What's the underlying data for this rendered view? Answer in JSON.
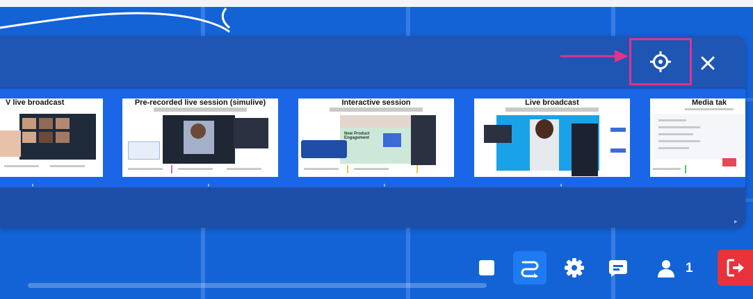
{
  "slides": [
    {
      "title": "V live broadcast"
    },
    {
      "title": "Pre-recorded live session (simulive)"
    },
    {
      "title": "Interactive session"
    },
    {
      "title": "Live broadcast"
    },
    {
      "title": "Media tak"
    }
  ],
  "interactive_thumb_overlay": "New Product Engagement",
  "toolbar": {
    "participant_count": "1"
  },
  "colors": {
    "highlight": "#e0338c",
    "leave": "#e8323c",
    "active_tool": "#1e7bf2"
  },
  "icons": {
    "recenter": "crosshair-icon",
    "close": "close-icon",
    "stop": "stop-square-icon",
    "route": "route-icon",
    "settings": "gear-icon",
    "chat": "chat-icon",
    "participants": "person-icon",
    "leave": "exit-icon"
  }
}
